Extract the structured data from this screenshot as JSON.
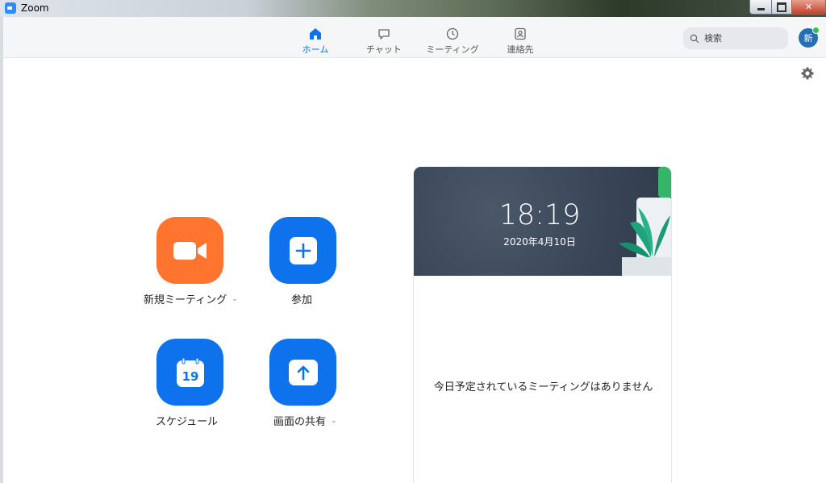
{
  "window": {
    "title": "Zoom"
  },
  "nav": {
    "tabs": [
      {
        "label": "ホーム",
        "icon": "home-icon",
        "active": true
      },
      {
        "label": "チャット",
        "icon": "chat-icon",
        "active": false
      },
      {
        "label": "ミーティング",
        "icon": "clock-icon",
        "active": false
      },
      {
        "label": "連絡先",
        "icon": "contacts-icon",
        "active": false
      }
    ],
    "search_placeholder": "検索",
    "avatar_text": "新"
  },
  "actions": {
    "new_meeting": "新規ミーティング",
    "join": "参加",
    "schedule": "スケジュール",
    "schedule_day": "19",
    "share_screen": "画面の共有"
  },
  "card": {
    "time": "18:19",
    "date": "2020年4月10日",
    "empty_message": "今日予定されているミーティングはありません"
  },
  "colors": {
    "accent": "#0e72ed",
    "new_meeting_tile": "#ff742e",
    "status_online": "#2fbf4a"
  }
}
